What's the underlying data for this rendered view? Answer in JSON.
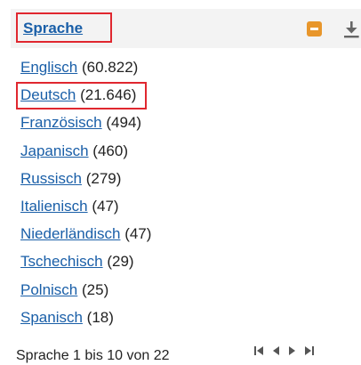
{
  "header": {
    "title": "Sprache"
  },
  "facet_items": [
    {
      "label": "Englisch",
      "count": "(60.822)"
    },
    {
      "label": "Deutsch",
      "count": "(21.646)"
    },
    {
      "label": "Französisch",
      "count": "(494)"
    },
    {
      "label": "Japanisch",
      "count": "(460)"
    },
    {
      "label": "Russisch",
      "count": "(279)"
    },
    {
      "label": "Italienisch",
      "count": "(47)"
    },
    {
      "label": "Niederländisch",
      "count": "(47)"
    },
    {
      "label": "Tschechisch",
      "count": "(29)"
    },
    {
      "label": "Polnisch",
      "count": "(25)"
    },
    {
      "label": "Spanisch",
      "count": "(18)"
    }
  ],
  "footer": {
    "range_text": "Sprache 1 bis 10 von 22"
  },
  "icons": {
    "collapse": "minus-square-icon",
    "download": "download-icon",
    "first": "first-page-icon",
    "prev": "prev-page-icon",
    "next": "next-page-icon",
    "last": "last-page-icon"
  },
  "colors": {
    "link": "#1a5fa8",
    "highlight": "#e0272f",
    "collapse_button": "#e8962b",
    "header_bg": "#f3f3f3"
  }
}
